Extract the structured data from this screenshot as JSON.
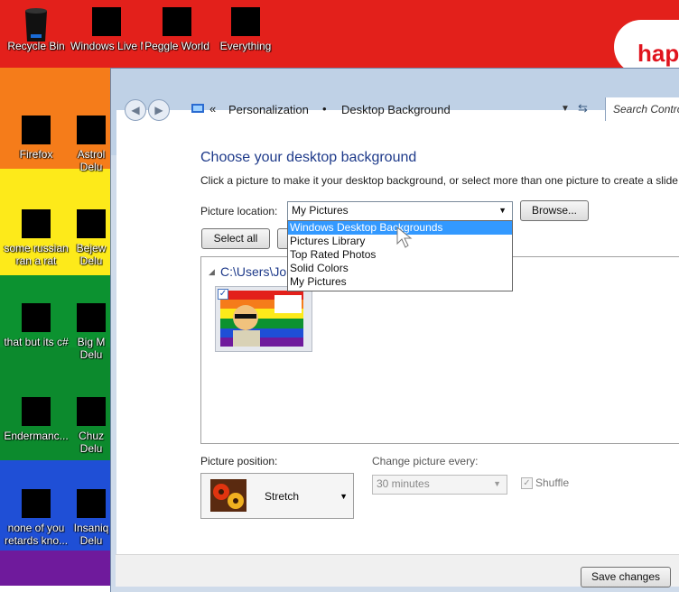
{
  "desktop": {
    "icons": [
      {
        "label": "Recycle Bin"
      },
      {
        "label": "Windows Live Mai"
      },
      {
        "label": "Peggle World"
      },
      {
        "label": "Everything"
      },
      {
        "label": "Firefox"
      },
      {
        "label": "Astrol Delu"
      },
      {
        "label": "some russian ran a rat"
      },
      {
        "label": "Bejew Delu"
      },
      {
        "label": "that but its c#"
      },
      {
        "label": "Big M Delu"
      },
      {
        "label": "Endermanc..."
      },
      {
        "label": "Chuz Delu"
      },
      {
        "label": "none of you retards kno..."
      },
      {
        "label": "Insaniq Delu"
      }
    ],
    "cloud_text": "hap"
  },
  "window": {
    "breadcrumb": {
      "sep": "«",
      "item1": "Personalization",
      "bullet": "•",
      "item2": "Desktop Background"
    },
    "search_placeholder": "Search Contro",
    "heading": "Choose your desktop background",
    "description": "Click a picture to make it your desktop background, or select more than one picture to create a slide s",
    "picture_location_label": "Picture location:",
    "picture_location_value": "My Pictures",
    "browse_label": "Browse...",
    "select_all_label": "Select all",
    "dropdown_options": [
      "Windows Desktop Backgrounds",
      "Pictures Library",
      "Top Rated Photos",
      "Solid Colors",
      "My Pictures"
    ],
    "folder_path": "C:\\Users\\Jo",
    "picture_position_label": "Picture position:",
    "picture_position_value": "Stretch",
    "change_every_label": "Change picture every:",
    "change_every_value": "30 minutes",
    "shuffle_label": "Shuffle",
    "save_label": "Save changes"
  }
}
